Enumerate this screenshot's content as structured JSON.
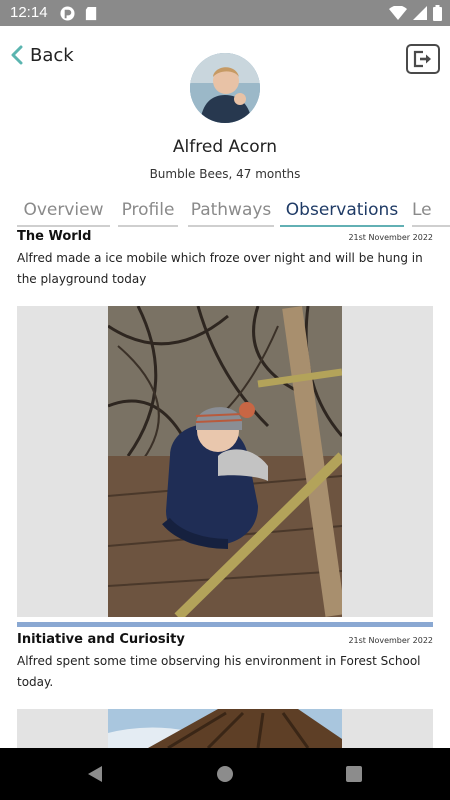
{
  "status_bar": {
    "time": "12:14",
    "icons": [
      "pocket-app-icon",
      "sd-card-icon",
      "wifi-icon",
      "cellular-signal-icon",
      "battery-icon"
    ]
  },
  "header": {
    "back_label": "Back",
    "logout_icon": "logout-icon"
  },
  "profile": {
    "name": "Alfred Acorn",
    "subtitle": "Bumble Bees, 47 months"
  },
  "tabs": [
    {
      "label": "Overview",
      "active": false
    },
    {
      "label": "Profile",
      "active": false
    },
    {
      "label": "Pathways",
      "active": false
    },
    {
      "label": "Observations",
      "active": true
    },
    {
      "label": "Le",
      "active": false
    }
  ],
  "observations": [
    {
      "title": "The World",
      "date": "21st November 2022",
      "text": "Alfred made a ice mobile which froze over night and will be hung in the playground today"
    },
    {
      "title": "Initiative and Curiosity",
      "date": "21st November 2022",
      "text": "Alfred spent some time observing his environment in Forest School today."
    }
  ],
  "colors": {
    "active_tab_text": "#1f3b66",
    "active_tab_underline": "#62b0b4",
    "divider": "#8aa8d2",
    "back_chevron": "#5bb5b0"
  },
  "nav": {
    "icons": [
      "back-triangle-icon",
      "home-circle-icon",
      "recents-square-icon"
    ]
  }
}
